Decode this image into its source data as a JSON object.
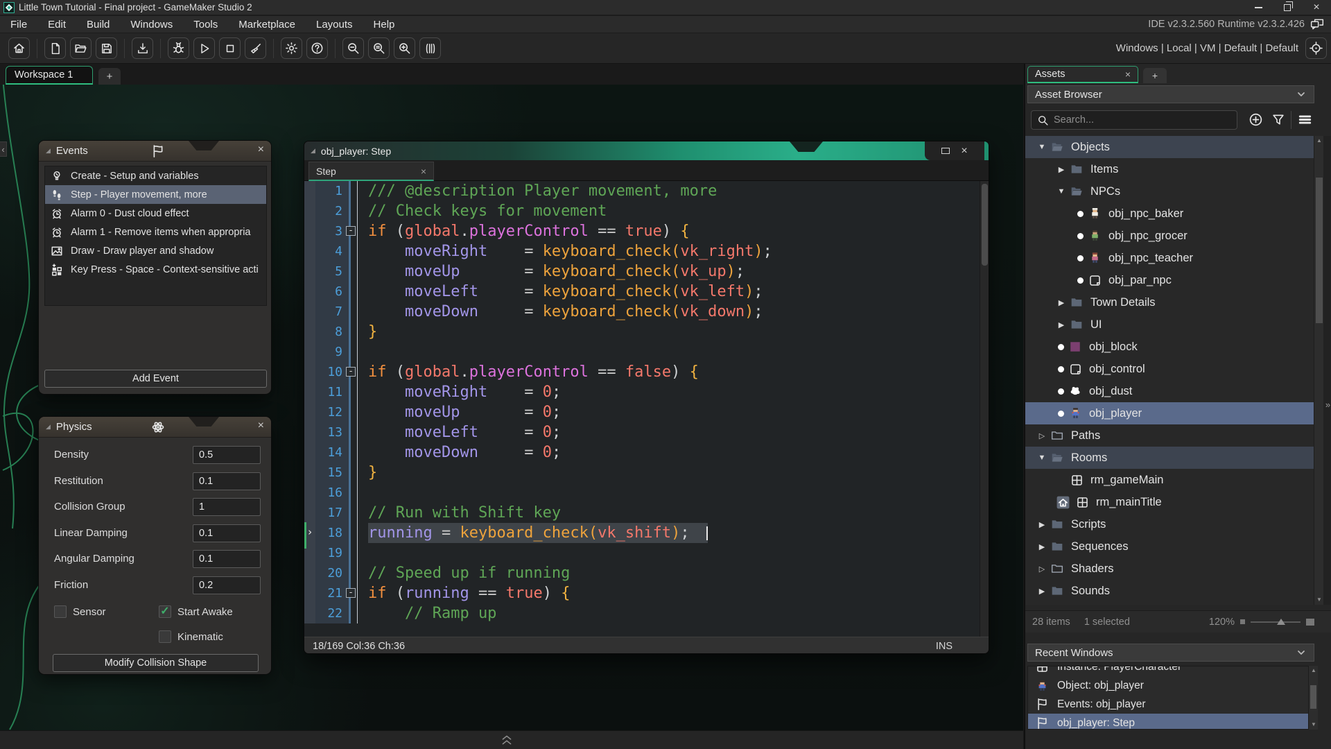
{
  "window": {
    "title": "Little Town Tutorial - Final project - GameMaker Studio 2"
  },
  "menu": {
    "items": [
      "File",
      "Edit",
      "Build",
      "Windows",
      "Tools",
      "Marketplace",
      "Layouts",
      "Help"
    ],
    "version_text": "IDE v2.3.2.560  Runtime v2.3.2.426"
  },
  "toolbar": {
    "groups": [
      [
        "home"
      ],
      [
        "new-project",
        "open-project",
        "save-project"
      ],
      [
        "create-executable"
      ],
      [
        "debug",
        "run",
        "stop",
        "clean"
      ],
      [
        "settings",
        "help"
      ],
      [
        "zoom-out",
        "zoom-reset",
        "zoom-in",
        "windowed-view"
      ]
    ],
    "target_text": "Windows | Local | VM | Default | Default"
  },
  "workspace_tabs": {
    "active": "Workspace 1",
    "new_tab": "+"
  },
  "events_panel": {
    "title": "Events",
    "items": [
      {
        "icon": "create-event-icon",
        "label": "Create - Setup and variables",
        "selected": false
      },
      {
        "icon": "step-event-icon",
        "label": "Step - Player movement, more",
        "selected": true
      },
      {
        "icon": "alarm-event-icon",
        "label": "Alarm 0 - Dust cloud effect",
        "selected": false
      },
      {
        "icon": "alarm-event-icon",
        "label": "Alarm 1 - Remove items when appropria",
        "selected": false
      },
      {
        "icon": "draw-event-icon",
        "label": "Draw - Draw player and shadow",
        "selected": false
      },
      {
        "icon": "keypress-event-icon",
        "label": "Key Press - Space - Context-sensitive acti",
        "selected": false
      }
    ],
    "add_button": "Add Event"
  },
  "physics_panel": {
    "title": "Physics",
    "fields": [
      {
        "label": "Density",
        "value": "0.5"
      },
      {
        "label": "Restitution",
        "value": "0.1"
      },
      {
        "label": "Collision Group",
        "value": "1"
      },
      {
        "label": "Linear Damping",
        "value": "0.1"
      },
      {
        "label": "Angular Damping",
        "value": "0.1"
      },
      {
        "label": "Friction",
        "value": "0.2"
      }
    ],
    "checkboxes": [
      {
        "label": "Sensor",
        "checked": false
      },
      {
        "label": "Start Awake",
        "checked": true
      },
      {
        "label": "Kinematic",
        "checked": false
      }
    ],
    "modify_button": "Modify Collision Shape"
  },
  "code_editor": {
    "title": "obj_player: Step",
    "tab_label": "Step",
    "status_left": "18/169 Col:36 Ch:36",
    "status_right": "INS",
    "current_line": 18,
    "lines": [
      {
        "n": 1,
        "tokens": [
          {
            "c": "com",
            "t": "/// @description Player movement, more"
          }
        ]
      },
      {
        "n": 2,
        "tokens": [
          {
            "c": "com",
            "t": "// Check keys for movement"
          }
        ]
      },
      {
        "n": 3,
        "fold": true,
        "tokens": [
          {
            "c": "kw",
            "t": "if"
          },
          {
            "c": "pl",
            "t": " ("
          },
          {
            "c": "gl",
            "t": "global"
          },
          {
            "c": "pl",
            "t": "."
          },
          {
            "c": "fl",
            "t": "playerControl"
          },
          {
            "c": "pl",
            "t": " "
          },
          {
            "c": "op",
            "t": "=="
          },
          {
            "c": "pl",
            "t": " "
          },
          {
            "c": "cs",
            "t": "true"
          },
          {
            "c": "pl",
            "t": ") "
          },
          {
            "c": "br",
            "t": "{"
          }
        ]
      },
      {
        "n": 4,
        "tokens": [
          {
            "c": "pl",
            "t": "    "
          },
          {
            "c": "vr",
            "t": "moveRight"
          },
          {
            "c": "pl",
            "t": "    "
          },
          {
            "c": "op",
            "t": "="
          },
          {
            "c": "pl",
            "t": " "
          },
          {
            "c": "fn",
            "t": "keyboard_check("
          },
          {
            "c": "cs",
            "t": "vk_right"
          },
          {
            "c": "fn",
            "t": ")"
          },
          {
            "c": "pl",
            "t": ";"
          }
        ]
      },
      {
        "n": 5,
        "tokens": [
          {
            "c": "pl",
            "t": "    "
          },
          {
            "c": "vr",
            "t": "moveUp"
          },
          {
            "c": "pl",
            "t": "       "
          },
          {
            "c": "op",
            "t": "="
          },
          {
            "c": "pl",
            "t": " "
          },
          {
            "c": "fn",
            "t": "keyboard_check("
          },
          {
            "c": "cs",
            "t": "vk_up"
          },
          {
            "c": "fn",
            "t": ")"
          },
          {
            "c": "pl",
            "t": ";"
          }
        ]
      },
      {
        "n": 6,
        "tokens": [
          {
            "c": "pl",
            "t": "    "
          },
          {
            "c": "vr",
            "t": "moveLeft"
          },
          {
            "c": "pl",
            "t": "     "
          },
          {
            "c": "op",
            "t": "="
          },
          {
            "c": "pl",
            "t": " "
          },
          {
            "c": "fn",
            "t": "keyboard_check("
          },
          {
            "c": "cs",
            "t": "vk_left"
          },
          {
            "c": "fn",
            "t": ")"
          },
          {
            "c": "pl",
            "t": ";"
          }
        ]
      },
      {
        "n": 7,
        "tokens": [
          {
            "c": "pl",
            "t": "    "
          },
          {
            "c": "vr",
            "t": "moveDown"
          },
          {
            "c": "pl",
            "t": "     "
          },
          {
            "c": "op",
            "t": "="
          },
          {
            "c": "pl",
            "t": " "
          },
          {
            "c": "fn",
            "t": "keyboard_check("
          },
          {
            "c": "cs",
            "t": "vk_down"
          },
          {
            "c": "fn",
            "t": ")"
          },
          {
            "c": "pl",
            "t": ";"
          }
        ]
      },
      {
        "n": 8,
        "tokens": [
          {
            "c": "br",
            "t": "}"
          }
        ]
      },
      {
        "n": 9,
        "tokens": []
      },
      {
        "n": 10,
        "fold": true,
        "tokens": [
          {
            "c": "kw",
            "t": "if"
          },
          {
            "c": "pl",
            "t": " ("
          },
          {
            "c": "gl",
            "t": "global"
          },
          {
            "c": "pl",
            "t": "."
          },
          {
            "c": "fl",
            "t": "playerControl"
          },
          {
            "c": "pl",
            "t": " "
          },
          {
            "c": "op",
            "t": "=="
          },
          {
            "c": "pl",
            "t": " "
          },
          {
            "c": "cs",
            "t": "false"
          },
          {
            "c": "pl",
            "t": ") "
          },
          {
            "c": "br",
            "t": "{"
          }
        ]
      },
      {
        "n": 11,
        "tokens": [
          {
            "c": "pl",
            "t": "    "
          },
          {
            "c": "vr",
            "t": "moveRight"
          },
          {
            "c": "pl",
            "t": "    "
          },
          {
            "c": "op",
            "t": "="
          },
          {
            "c": "pl",
            "t": " "
          },
          {
            "c": "cs",
            "t": "0"
          },
          {
            "c": "pl",
            "t": ";"
          }
        ]
      },
      {
        "n": 12,
        "tokens": [
          {
            "c": "pl",
            "t": "    "
          },
          {
            "c": "vr",
            "t": "moveUp"
          },
          {
            "c": "pl",
            "t": "       "
          },
          {
            "c": "op",
            "t": "="
          },
          {
            "c": "pl",
            "t": " "
          },
          {
            "c": "cs",
            "t": "0"
          },
          {
            "c": "pl",
            "t": ";"
          }
        ]
      },
      {
        "n": 13,
        "tokens": [
          {
            "c": "pl",
            "t": "    "
          },
          {
            "c": "vr",
            "t": "moveLeft"
          },
          {
            "c": "pl",
            "t": "     "
          },
          {
            "c": "op",
            "t": "="
          },
          {
            "c": "pl",
            "t": " "
          },
          {
            "c": "cs",
            "t": "0"
          },
          {
            "c": "pl",
            "t": ";"
          }
        ]
      },
      {
        "n": 14,
        "tokens": [
          {
            "c": "pl",
            "t": "    "
          },
          {
            "c": "vr",
            "t": "moveDown"
          },
          {
            "c": "pl",
            "t": "     "
          },
          {
            "c": "op",
            "t": "="
          },
          {
            "c": "pl",
            "t": " "
          },
          {
            "c": "cs",
            "t": "0"
          },
          {
            "c": "pl",
            "t": ";"
          }
        ]
      },
      {
        "n": 15,
        "tokens": [
          {
            "c": "br",
            "t": "}"
          }
        ]
      },
      {
        "n": 16,
        "tokens": []
      },
      {
        "n": 17,
        "tokens": [
          {
            "c": "com",
            "t": "// Run with Shift key"
          }
        ]
      },
      {
        "n": 18,
        "highlight": true,
        "tokens": [
          {
            "c": "vr",
            "t": "running"
          },
          {
            "c": "pl",
            "t": " "
          },
          {
            "c": "op",
            "t": "="
          },
          {
            "c": "pl",
            "t": " "
          },
          {
            "c": "fn",
            "t": "keyboard_check("
          },
          {
            "c": "cs",
            "t": "vk_shift"
          },
          {
            "c": "fn",
            "t": ")"
          },
          {
            "c": "pl",
            "t": ";"
          }
        ]
      },
      {
        "n": 19,
        "tokens": []
      },
      {
        "n": 20,
        "tokens": [
          {
            "c": "com",
            "t": "// Speed up if running"
          }
        ]
      },
      {
        "n": 21,
        "fold": true,
        "tokens": [
          {
            "c": "kw",
            "t": "if"
          },
          {
            "c": "pl",
            "t": " ("
          },
          {
            "c": "vr",
            "t": "running"
          },
          {
            "c": "pl",
            "t": " "
          },
          {
            "c": "op",
            "t": "=="
          },
          {
            "c": "pl",
            "t": " "
          },
          {
            "c": "cs",
            "t": "true"
          },
          {
            "c": "pl",
            "t": ") "
          },
          {
            "c": "br",
            "t": "{"
          }
        ]
      },
      {
        "n": 22,
        "tokens": [
          {
            "c": "com",
            "t": "    // Ramp up"
          }
        ]
      }
    ]
  },
  "asset_browser": {
    "tab": "Assets",
    "new_tab": "+",
    "dropdown_label": "Asset Browser",
    "search_placeholder": "Search...",
    "tree": [
      {
        "label": "Objects",
        "depth": 0,
        "arrow": "down",
        "icon": "folder-open-icon",
        "header": true
      },
      {
        "label": "Items",
        "depth": 1,
        "arrow": "right",
        "icon": "folder-icon"
      },
      {
        "label": "NPCs",
        "depth": 1,
        "arrow": "down",
        "icon": "folder-open-icon"
      },
      {
        "label": "obj_npc_baker",
        "depth": 2,
        "bullet": true,
        "icon": "baker-sprite-icon"
      },
      {
        "label": "obj_npc_grocer",
        "depth": 2,
        "bullet": true,
        "icon": "grocer-sprite-icon"
      },
      {
        "label": "obj_npc_teacher",
        "depth": 2,
        "bullet": true,
        "icon": "teacher-sprite-icon"
      },
      {
        "label": "obj_par_npc",
        "depth": 2,
        "bullet": true,
        "icon": "object-blank-icon"
      },
      {
        "label": "Town Details",
        "depth": 1,
        "arrow": "right",
        "icon": "folder-icon"
      },
      {
        "label": "UI",
        "depth": 1,
        "arrow": "right",
        "icon": "folder-icon"
      },
      {
        "label": "obj_block",
        "depth": 1,
        "bullet": true,
        "icon": "block-sprite-icon"
      },
      {
        "label": "obj_control",
        "depth": 1,
        "bullet": true,
        "icon": "object-blank-icon"
      },
      {
        "label": "obj_dust",
        "depth": 1,
        "bullet": true,
        "icon": "dust-sprite-icon"
      },
      {
        "label": "obj_player",
        "depth": 1,
        "bullet": true,
        "icon": "player-sprite-icon",
        "selected": true
      },
      {
        "label": "Paths",
        "depth": 0,
        "arrow": "right-outline",
        "icon": "folder-outline-icon"
      },
      {
        "label": "Rooms",
        "depth": 0,
        "arrow": "down",
        "icon": "folder-open-icon",
        "header": true
      },
      {
        "label": "rm_gameMain",
        "depth": 1,
        "icon": "room-icon"
      },
      {
        "label": "rm_mainTitle",
        "depth": 1,
        "home": true,
        "icon": "room-icon"
      },
      {
        "label": "Scripts",
        "depth": 0,
        "arrow": "right",
        "icon": "folder-icon"
      },
      {
        "label": "Sequences",
        "depth": 0,
        "arrow": "right",
        "icon": "folder-icon"
      },
      {
        "label": "Shaders",
        "depth": 0,
        "arrow": "right-outline",
        "icon": "folder-outline-icon"
      },
      {
        "label": "Sounds",
        "depth": 0,
        "arrow": "right",
        "icon": "folder-icon"
      }
    ],
    "footer": {
      "items_text": "28 items",
      "selected_text": "1 selected",
      "zoom_text": "120%"
    },
    "recent": {
      "dropdown_label": "Recent Windows",
      "items": [
        {
          "icon": "room-icon",
          "label": "Instance: PlayerCharacter",
          "partial": true,
          "selected": false
        },
        {
          "icon": "player-sprite-icon",
          "label": "Object: obj_player",
          "selected": false
        },
        {
          "icon": "flag-icon",
          "label": "Events: obj_player",
          "selected": false
        },
        {
          "icon": "flag-icon",
          "label": "obj_player: Step",
          "selected": true
        }
      ]
    }
  }
}
